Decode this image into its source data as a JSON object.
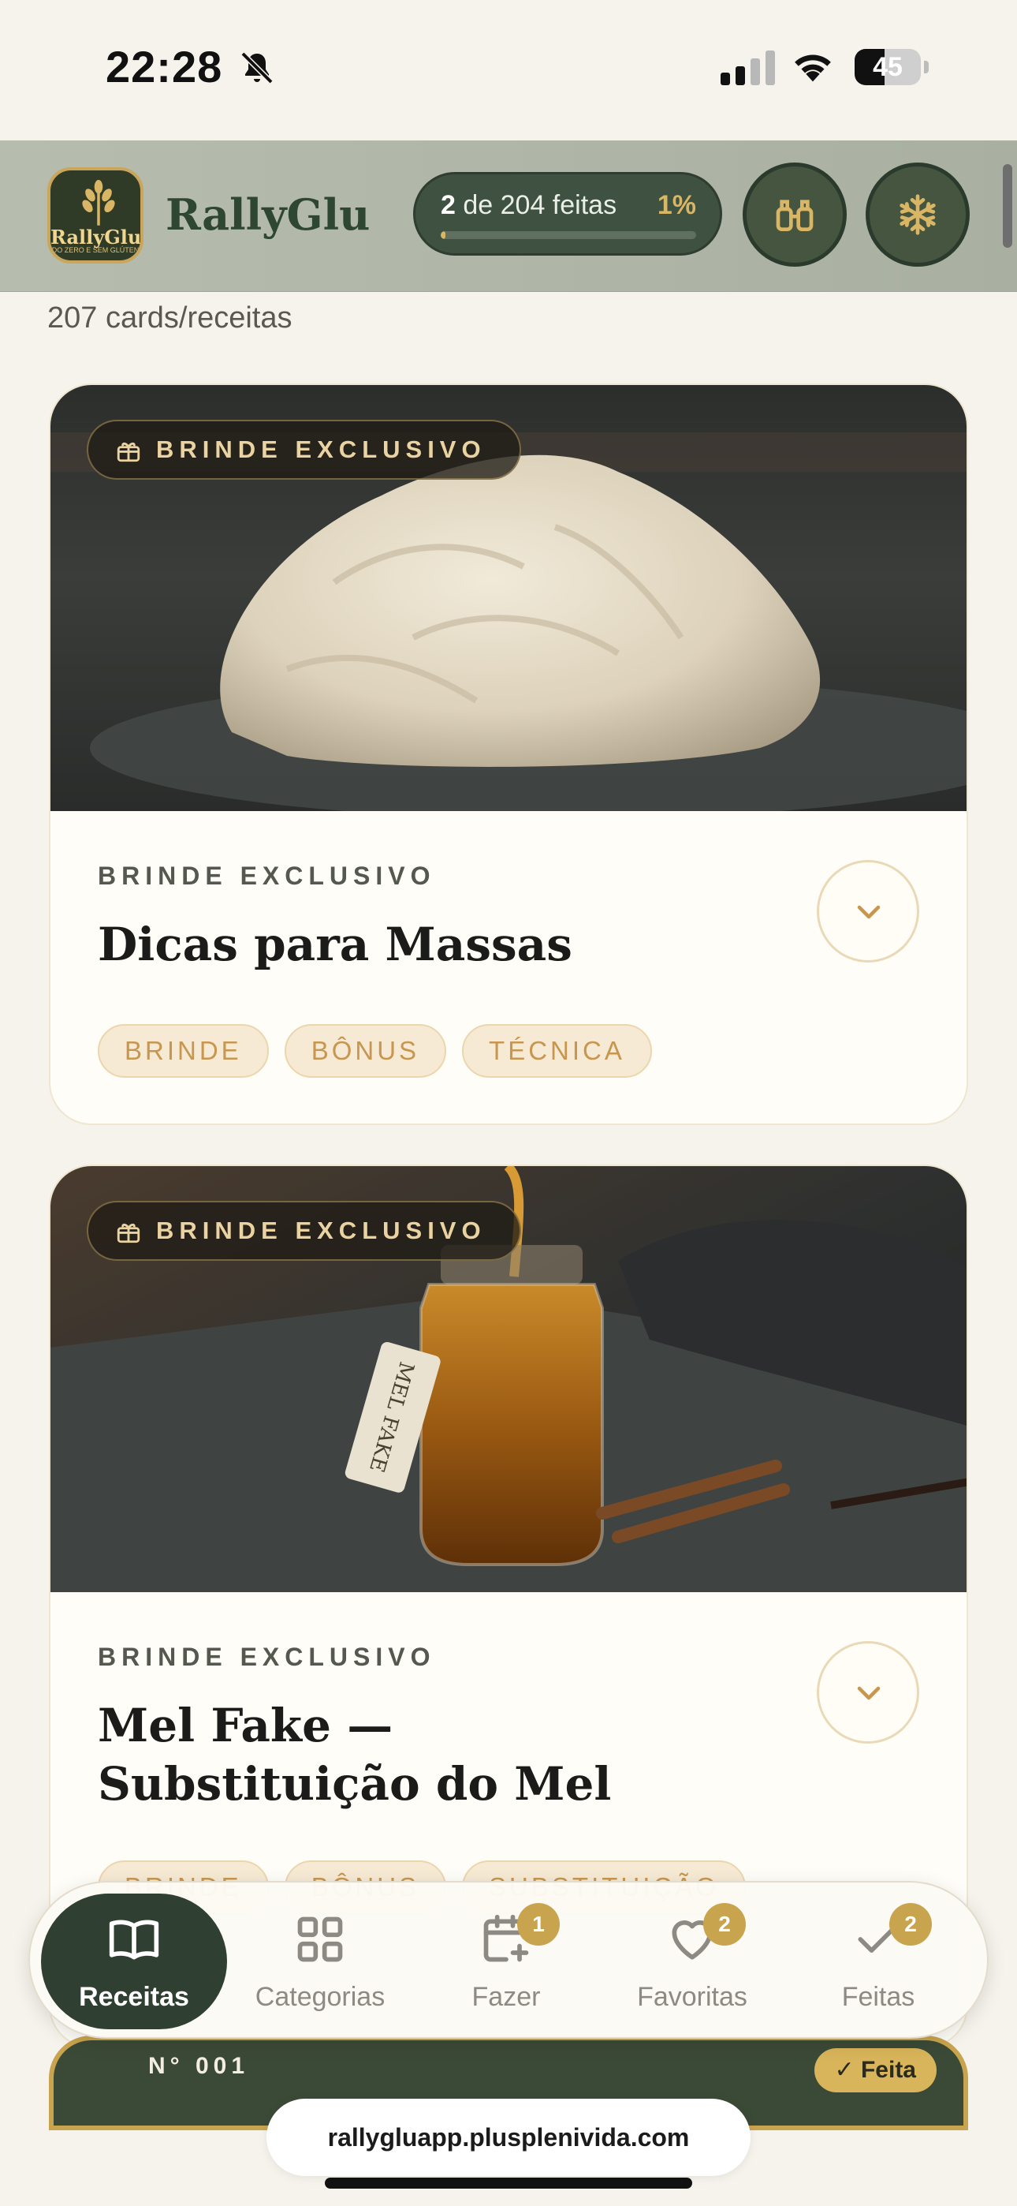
{
  "status_bar": {
    "time": "22:28",
    "battery_level": "45"
  },
  "header": {
    "brand": "RallyGlu",
    "logo_text": "RallyGlu",
    "logo_subtext": "DO ZERO E SEM GLÚTEN",
    "progress_done": "2",
    "progress_rest": " de 204 feitas",
    "progress_percent": "1%",
    "progress_fraction": 0.01,
    "accent_color": "#c9a44e"
  },
  "count_label": "207 cards/receitas",
  "cards": [
    {
      "badge": "BRINDE EXCLUSIVO",
      "eyebrow": "BRINDE EXCLUSIVO",
      "title": "Dicas para Massas",
      "tags": [
        "BRINDE",
        "BÔNUS",
        "TÉCNICA"
      ]
    },
    {
      "badge": "BRINDE EXCLUSIVO",
      "eyebrow": "BRINDE EXCLUSIVO",
      "title_line1": "Mel Fake —",
      "title_line2": "Substituição do Mel",
      "tags": [
        "BRINDE",
        "BÔNUS",
        "SUBSTITUIÇÃO"
      ],
      "jar_label": "MEL FAKE"
    }
  ],
  "peek_card": {
    "number": "N° 001",
    "done_label": "✓ Feita"
  },
  "nav": {
    "items": [
      {
        "label": "Receitas",
        "icon": "book-icon"
      },
      {
        "label": "Categorias",
        "icon": "grid-icon"
      },
      {
        "label": "Fazer",
        "icon": "calendar-plus-icon",
        "badge": "1"
      },
      {
        "label": "Favoritas",
        "icon": "heart-icon",
        "badge": "2"
      },
      {
        "label": "Feitas",
        "icon": "check-icon",
        "badge": "2"
      }
    ]
  },
  "browser": {
    "url": "rallygluapp.plusplenivida.com"
  }
}
